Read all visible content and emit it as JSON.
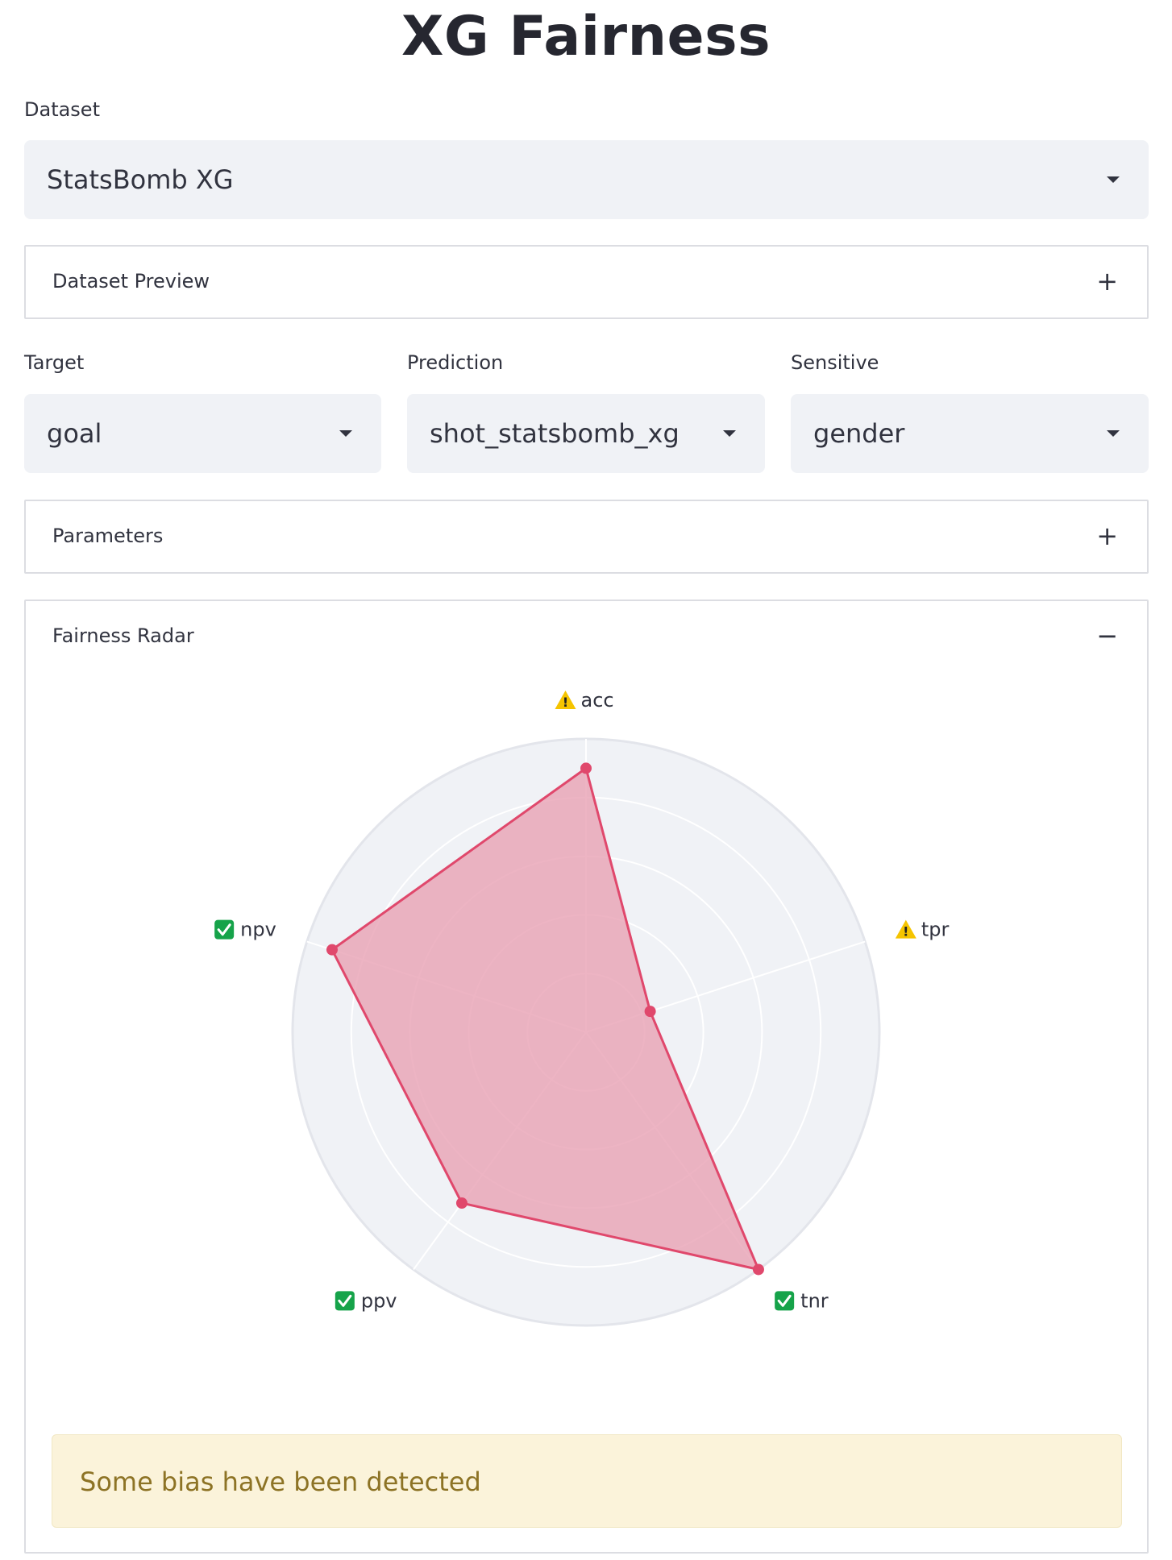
{
  "title": "XG Fairness",
  "dataset": {
    "label": "Dataset",
    "selected": "StatsBomb XG"
  },
  "preview": {
    "label": "Dataset Preview",
    "toggle": "+"
  },
  "target": {
    "label": "Target",
    "selected": "goal"
  },
  "prediction": {
    "label": "Prediction",
    "selected": "shot_statsbomb_xg"
  },
  "sensitive": {
    "label": "Sensitive",
    "selected": "gender"
  },
  "parameters": {
    "label": "Parameters",
    "toggle": "+"
  },
  "radar": {
    "label": "Fairness Radar",
    "toggle": "−"
  },
  "alert": {
    "message": "Some bias have been detected"
  },
  "colors": {
    "accent": "#e0486c",
    "fill": "#e8a1b4",
    "bg_polar": "#f0f2f6",
    "warning": "#f5c400",
    "check": "#16a34a"
  },
  "chart_data": {
    "type": "radar",
    "categories": [
      "acc",
      "tpr",
      "tnr",
      "ppv",
      "npv"
    ],
    "status": [
      "warning",
      "warning",
      "ok",
      "ok",
      "ok"
    ],
    "status_icons": {
      "warning": "warning-icon",
      "ok": "check-icon"
    },
    "values": [
      0.9,
      0.23,
      1.0,
      0.72,
      0.91
    ],
    "range": [
      0,
      1
    ],
    "grid": true,
    "rings": 5
  }
}
